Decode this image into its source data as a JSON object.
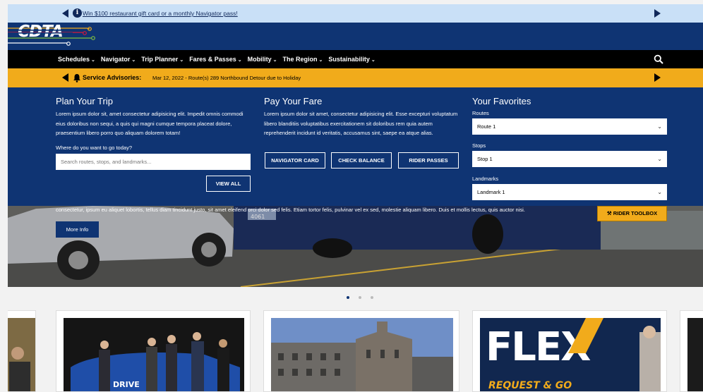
{
  "promo": {
    "link_text": "Win $100 restaurant gift card or a monthly Navigator pass!",
    "info_glyph": "i"
  },
  "brand": {
    "logo_text": "CDTA",
    "line_colors": [
      "#f1ab1b",
      "#d8173a",
      "#7fbf3f",
      "#ffffff"
    ]
  },
  "nav": {
    "items": [
      {
        "label": "Schedules"
      },
      {
        "label": "Navigator"
      },
      {
        "label": "Trip Planner"
      },
      {
        "label": "Fares & Passes"
      },
      {
        "label": "Mobility"
      },
      {
        "label": "The Region"
      },
      {
        "label": "Sustainability"
      }
    ],
    "chevron": "❯"
  },
  "advisory": {
    "label": "Service Advisories:",
    "text": "Mar 12, 2022 - Route(s) 289 Northbound Detour due to Holiday"
  },
  "plan_trip": {
    "title": "Plan Your Trip",
    "body": "Lorem ipsum dolor sit, amet consectetur adipisicing elit. Impedit omnis commodi eius doloribus non sequi, a quis qui magni cumque tempora placeat dolore, praesentium libero porro quo aliquam dolorem totam!",
    "input_label": "Where do you want to go today?",
    "input_placeholder": "Search routes, stops, and landmarks...",
    "view_all": "VIEW ALL"
  },
  "pay_fare": {
    "title": "Pay Your Fare",
    "body": "Lorem ipsum dolor sit amet, consectetur adipisicing elit. Esse excepturi voluptatum libero blanditiis voluptatibus exercitationem sit doloribus rem quia autem reprehenderit incidunt id veritatis, accusamus sint, saepe ea atque alias.",
    "buttons": [
      "NAVIGATOR CARD",
      "CHECK BALANCE",
      "RIDER PASSES"
    ]
  },
  "favorites": {
    "title": "Your Favorites",
    "routes_label": "Routes",
    "routes_value": "Route 1",
    "stops_label": "Stops",
    "stops_value": "Stop 1",
    "landmarks_label": "Landmarks",
    "landmarks_value": "Landmark 1"
  },
  "hero": {
    "caption": "consectetur, ipsum eu aliquet lobortis, tellus diam tincidunt justo, sit amet eleifend orci dolor sed felis. Etiam tortor felis, pulvinar vel ex sed, molestie aliquam libero. Duis et mollis lectus, quis auctor nisi.",
    "more_info": "More Info",
    "toolbox": "RIDER TOOLBOX",
    "bus_number": "4061"
  },
  "carousel": {
    "active_dot_color": "#0f3473",
    "inactive_dot_color": "#bbbbbb"
  },
  "cards": {
    "flex_text": "FLEX",
    "request_text": "REQUEST & GO",
    "drive_text": "DRIVE"
  }
}
